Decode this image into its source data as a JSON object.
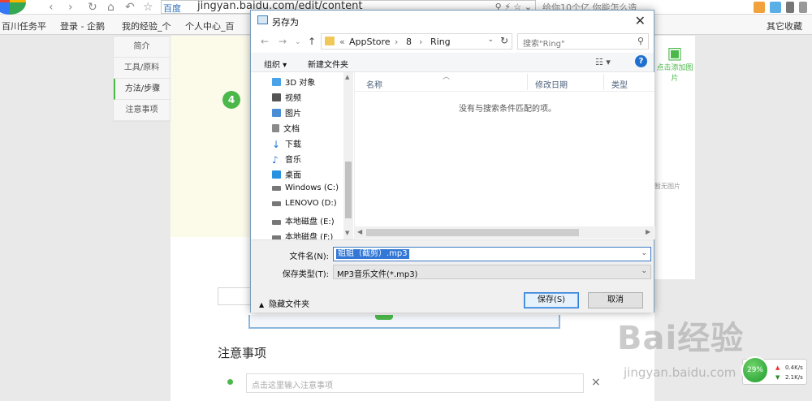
{
  "browser": {
    "engine": "百度",
    "url": "jingyan.baidu.com/edit/content",
    "search_hint": "给你10个亿 你能怎么造"
  },
  "bookmarks": [
    {
      "label": "百川任务平"
    },
    {
      "label": "登录 - 企鹅"
    },
    {
      "label": "我的经验_个"
    },
    {
      "label": "个人中心_百"
    },
    {
      "label": "其它收藏"
    }
  ],
  "page": {
    "sidenav": [
      "简介",
      "工具/原料",
      "方法/步骤",
      "注意事项"
    ],
    "step_number": "4",
    "add_image": "点击添加图片",
    "no_image": "暂无图片",
    "notes_title": "注意事项",
    "notes_placeholder": "点击这里输入注意事项",
    "notes_close": "×"
  },
  "watermark": {
    "brand": "Bai经验",
    "domain": "jingyan.baidu.com"
  },
  "speed": {
    "up": "0.4K/s",
    "down": "2.1K/s",
    "percent": "29%"
  },
  "dialog": {
    "title": "另存为",
    "close": "✕",
    "breadcrumb": {
      "prefix": "«",
      "parts": [
        "AppStore",
        "8",
        "Ring"
      ]
    },
    "search_placeholder": "搜索\"Ring\"",
    "organize": "组织 ▾",
    "new_folder": "新建文件夹",
    "help": "?",
    "tree": [
      {
        "label": "3D 对象",
        "icon": "cube-icon",
        "color": "#4aa3e8"
      },
      {
        "label": "视频",
        "icon": "video-icon",
        "color": "#555"
      },
      {
        "label": "图片",
        "icon": "picture-icon",
        "color": "#4a8fd6"
      },
      {
        "label": "文档",
        "icon": "document-icon",
        "color": "#8a8a8a"
      },
      {
        "label": "下载",
        "icon": "download-icon",
        "color": "#2a78d6"
      },
      {
        "label": "音乐",
        "icon": "music-icon",
        "color": "#2a78d6"
      },
      {
        "label": "桌面",
        "icon": "desktop-icon",
        "color": "#2a90e0"
      },
      {
        "label": "Windows (C:)",
        "icon": "drive-icon",
        "color": "#777"
      },
      {
        "label": "LENOVO (D:)",
        "icon": "drive-icon",
        "color": "#777"
      },
      {
        "label": "本地磁盘 (E:)",
        "icon": "drive-icon",
        "color": "#777"
      },
      {
        "label": "本地磁盘 (F:)",
        "icon": "drive-icon",
        "color": "#777"
      }
    ],
    "columns": [
      "名称",
      "修改日期",
      "类型"
    ],
    "empty_message": "没有与搜索条件匹配的项。",
    "filename_label": "文件名(N):",
    "filename_value": "姐姐（截剪）.mp3",
    "filetype_label": "保存类型(T):",
    "filetype_value": "MP3音乐文件(*.mp3)",
    "hide_folders": "隐藏文件夹",
    "save_button": "保存(S)",
    "cancel_button": "取消"
  }
}
